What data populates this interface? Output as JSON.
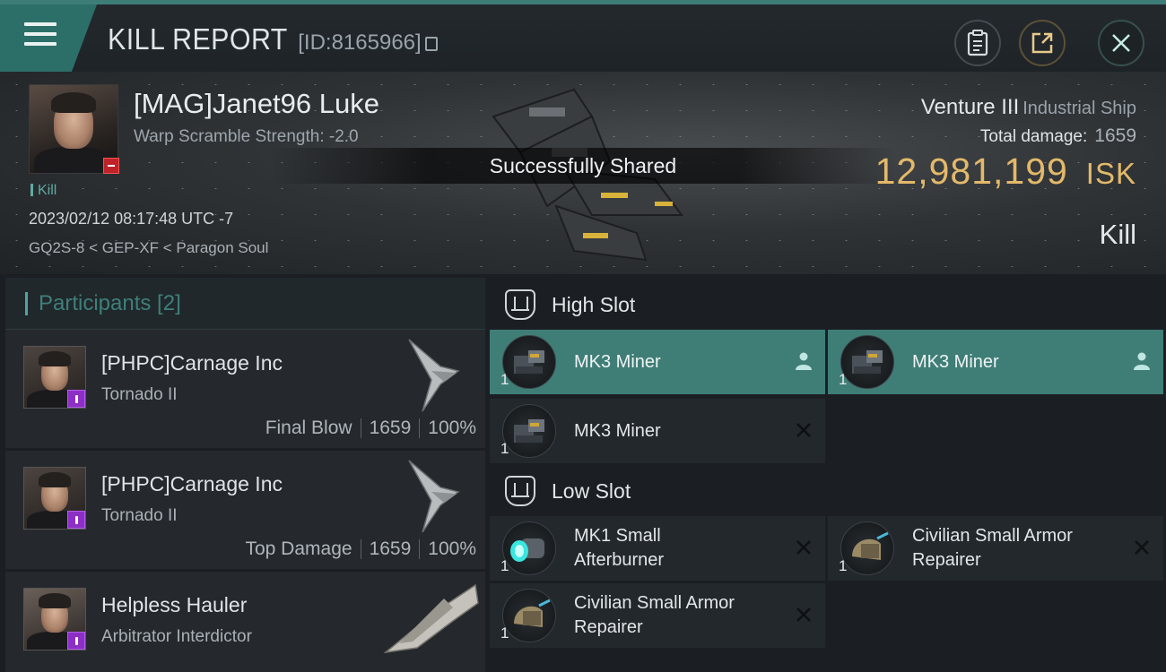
{
  "topbar": {
    "title": "KILL REPORT",
    "report_id": "[ID:8165966]",
    "icons": [
      "menu-icon",
      "copy-icon",
      "clipboard-icon",
      "share-icon",
      "close-icon"
    ]
  },
  "victim": {
    "name": "[MAG]Janet96 Luke",
    "warp_scramble": "Warp Scramble Strength: -2.0",
    "tag": "Kill",
    "datetime": "2023/02/12 08:17:48 UTC -7",
    "location": "GQ2S-8 < GEP-XF < Paragon Soul",
    "ship_name": "Venture III",
    "ship_class": "Industrial Ship",
    "total_damage_label": "Total damage:",
    "total_damage": "1659",
    "isk_value": "12,981,199",
    "isk_unit": "ISK",
    "result": "Kill",
    "toast": "Successfully Shared"
  },
  "participants": {
    "header": "Participants [2]",
    "items": [
      {
        "name": "[PHPC]Carnage Inc",
        "ship": "Tornado II",
        "stat_label": "Final Blow",
        "damage": "1659",
        "percent": "100%"
      },
      {
        "name": "[PHPC]Carnage Inc",
        "ship": "Tornado II",
        "stat_label": "Top Damage",
        "damage": "1659",
        "percent": "100%"
      },
      {
        "name": "Helpless Hauler",
        "ship": "Arbitrator Interdictor",
        "stat_label": "",
        "damage": "",
        "percent": ""
      }
    ]
  },
  "fitting": {
    "high_slot_label": "High Slot",
    "low_slot_label": "Low Slot",
    "high_modules": [
      {
        "qty": "1",
        "name": "MK3 Miner",
        "state": "dropped"
      },
      {
        "qty": "1",
        "name": "MK3 Miner",
        "state": "dropped"
      },
      {
        "qty": "1",
        "name": "MK3 Miner",
        "state": "destroyed"
      }
    ],
    "low_modules": [
      {
        "qty": "1",
        "name": "MK1 Small Afterburner",
        "state": "destroyed"
      },
      {
        "qty": "1",
        "name": "Civilian Small Armor Repairer",
        "state": "destroyed"
      },
      {
        "qty": "1",
        "name": "Civilian Small Armor Repairer",
        "state": "destroyed"
      }
    ]
  },
  "colors": {
    "accent": "#3f7e77",
    "isk": "#e3b96a",
    "badge_purple": "#8c2fc6",
    "badge_red": "#c0222a"
  }
}
